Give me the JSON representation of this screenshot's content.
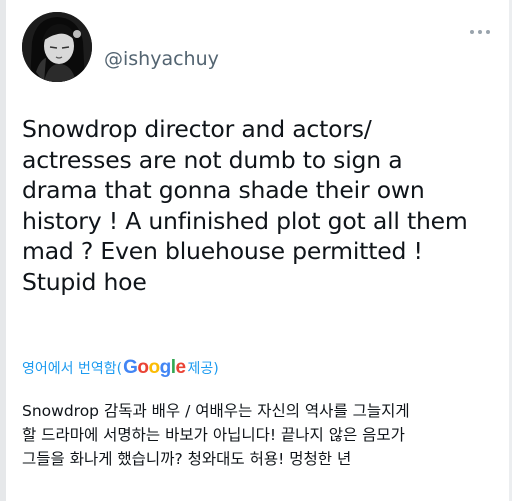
{
  "tweet": {
    "handle": "@ishyachuy",
    "text": "Snowdrop director and actors/\nactresses are not dumb to sign a\ndrama that gonna shade their own\nhistory ! A unfinished plot got all them\nmad ? Even bluehouse permitted !\nStupid hoe",
    "translation_prefix": "영어에서 번역함(",
    "translation_brand_letters": [
      "G",
      "o",
      "o",
      "g",
      "l",
      "e"
    ],
    "translation_suffix": " 제공)",
    "translated_text": "Snowdrop 감독과 배우 / 여배우는 자신의 역사를 그늘지게\n할 드라마에 서명하는 바보가 아닙니다! 끝나지 않은 음모가\n그들을 화나게 했습니까? 청와대도 허용! 멍청한 년"
  },
  "icons": {
    "avatar": "avatar-image",
    "more": "more-options-icon"
  },
  "colors": {
    "link": "#1d9bf0",
    "secondary_text": "#536471",
    "text": "#0f1419"
  }
}
